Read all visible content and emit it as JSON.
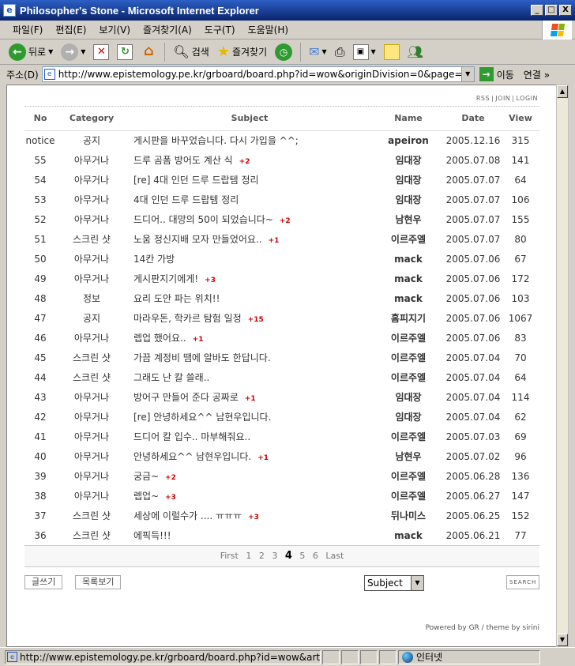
{
  "window": {
    "title": "Philosopher's Stone - Microsoft Internet Explorer",
    "controls": [
      "_",
      "□",
      "X"
    ]
  },
  "menu": [
    "파일(F)",
    "편집(E)",
    "보기(V)",
    "즐겨찾기(A)",
    "도구(T)",
    "도움말(H)"
  ],
  "toolbar": {
    "back": "뒤로",
    "search": "검색",
    "favorites": "즐겨찾기"
  },
  "address": {
    "label": "주소(D)",
    "url": "http://www.epistemology.pe.kr/grboard/board.php?id=wow&originDivision=0&page=4&divi",
    "go": "이동",
    "links": "연결"
  },
  "board": {
    "toplinks": [
      "RSS",
      "JOIN",
      "LOGIN"
    ],
    "columns": {
      "no": "No",
      "category": "Category",
      "subject": "Subject",
      "name": "Name",
      "date": "Date",
      "view": "View"
    },
    "rows": [
      {
        "no": "notice",
        "category": "공지",
        "subject": "게시판을 바꾸었습니다. 다시 가입을 ^^;",
        "comments": "",
        "name": "apeiron",
        "date": "2005.12.16",
        "view": "315"
      },
      {
        "no": "55",
        "category": "아무거나",
        "subject": "드루 곰폼 방어도 계산 식",
        "comments": "+2",
        "name": "임대장",
        "date": "2005.07.08",
        "view": "141"
      },
      {
        "no": "54",
        "category": "아무거나",
        "subject": "[re] 4대 인던 드루 드랍템 정리",
        "comments": "",
        "name": "임대장",
        "date": "2005.07.07",
        "view": "64"
      },
      {
        "no": "53",
        "category": "아무거나",
        "subject": "4대 인던 드루 드랍템 정리",
        "comments": "",
        "name": "임대장",
        "date": "2005.07.07",
        "view": "106"
      },
      {
        "no": "52",
        "category": "아무거나",
        "subject": "드디어.. 대망의 50이 되었습니다~",
        "comments": "+2",
        "name": "남현우",
        "date": "2005.07.07",
        "view": "155"
      },
      {
        "no": "51",
        "category": "스크린 샷",
        "subject": "노움 정신지배 모자 만들었어요..",
        "comments": "+1",
        "name": "이르주엘",
        "date": "2005.07.07",
        "view": "80"
      },
      {
        "no": "50",
        "category": "아무거나",
        "subject": "14칸 가방",
        "comments": "",
        "name": "mack",
        "date": "2005.07.06",
        "view": "67"
      },
      {
        "no": "49",
        "category": "아무거나",
        "subject": "게시판지기에게!",
        "comments": "+3",
        "name": "mack",
        "date": "2005.07.06",
        "view": "172"
      },
      {
        "no": "48",
        "category": "정보",
        "subject": "요리 도안 파는 위치!!",
        "comments": "",
        "name": "mack",
        "date": "2005.07.06",
        "view": "103"
      },
      {
        "no": "47",
        "category": "공지",
        "subject": "마라우돈, 학카르 탐험 일정",
        "comments": "+15",
        "name": "홈피지기",
        "date": "2005.07.06",
        "view": "1067"
      },
      {
        "no": "46",
        "category": "아무거나",
        "subject": "렙업 했어요..",
        "comments": "+1",
        "name": "이르주엘",
        "date": "2005.07.06",
        "view": "83"
      },
      {
        "no": "45",
        "category": "스크린 샷",
        "subject": "가끔 계정비 땜에 알바도 한답니다.",
        "comments": "",
        "name": "이르주엘",
        "date": "2005.07.04",
        "view": "70"
      },
      {
        "no": "44",
        "category": "스크린 샷",
        "subject": "그래도 난 칼 쓸래..",
        "comments": "",
        "name": "이르주엘",
        "date": "2005.07.04",
        "view": "64"
      },
      {
        "no": "43",
        "category": "아무거나",
        "subject": "방어구 만들어 준다 공짜로",
        "comments": "+1",
        "name": "임대장",
        "date": "2005.07.04",
        "view": "114"
      },
      {
        "no": "42",
        "category": "아무거나",
        "subject": "[re] 안녕하세요^^ 남현우입니다.",
        "comments": "",
        "name": "임대장",
        "date": "2005.07.04",
        "view": "62"
      },
      {
        "no": "41",
        "category": "아무거나",
        "subject": "드디어 칼 입수.. 마부해줘요..",
        "comments": "",
        "name": "이르주엘",
        "date": "2005.07.03",
        "view": "69"
      },
      {
        "no": "40",
        "category": "아무거나",
        "subject": "안녕하세요^^ 남현우입니다.",
        "comments": "+1",
        "name": "남현우",
        "date": "2005.07.02",
        "view": "96"
      },
      {
        "no": "39",
        "category": "아무거나",
        "subject": "궁금~",
        "comments": "+2",
        "name": "이르주엘",
        "date": "2005.06.28",
        "view": "136"
      },
      {
        "no": "38",
        "category": "아무거나",
        "subject": "렙업~",
        "comments": "+3",
        "name": "이르주엘",
        "date": "2005.06.27",
        "view": "147"
      },
      {
        "no": "37",
        "category": "스크린 샷",
        "subject": "세상에 이럴수가 .... ㅠㅠㅠ",
        "comments": "+3",
        "name": "뒤나미스",
        "date": "2005.06.25",
        "view": "152"
      },
      {
        "no": "36",
        "category": "스크린 샷",
        "subject": "에픽득!!!",
        "comments": "",
        "name": "mack",
        "date": "2005.06.21",
        "view": "77"
      }
    ],
    "pager": {
      "first": "First",
      "pages": [
        "1",
        "2",
        "3",
        "4",
        "5",
        "6"
      ],
      "current": "4",
      "last": "Last"
    },
    "write_button": "글쓰기",
    "list_button": "목록보기",
    "search_select": "Subject",
    "search_button": "SEARCH",
    "credit": "Powered by GR / theme by sirini"
  },
  "status": {
    "url": "http://www.epistemology.pe.kr/grboard/board.php?id=wow&articl",
    "zone": "인터넷"
  }
}
